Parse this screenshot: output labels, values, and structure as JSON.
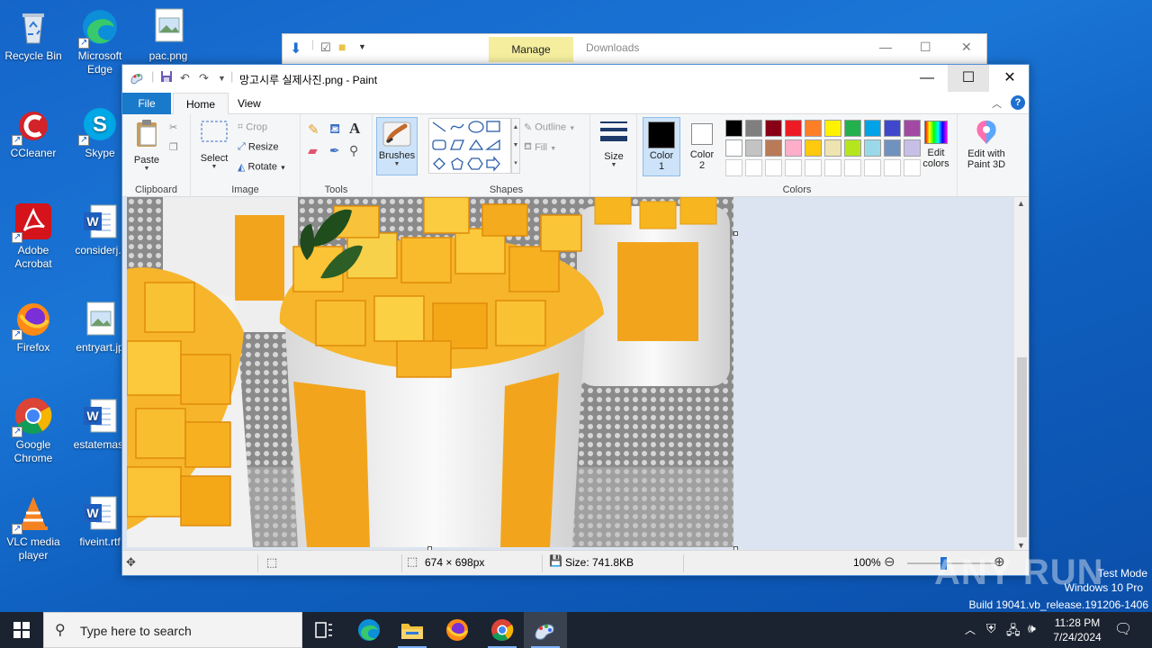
{
  "desktop": {
    "icons": [
      {
        "label": "Recycle Bin",
        "icon": "recycle-bin-icon"
      },
      {
        "label": "Microsoft Edge",
        "icon": "edge-icon"
      },
      {
        "label": "pac.png",
        "icon": "image-file-icon"
      },
      {
        "label": "CCleaner",
        "icon": "ccleaner-icon"
      },
      {
        "label": "Skype",
        "icon": "skype-icon"
      },
      {
        "label": "Adobe Acrobat",
        "icon": "acrobat-icon"
      },
      {
        "label": "considerj.r",
        "icon": "word-doc-icon"
      },
      {
        "label": "Firefox",
        "icon": "firefox-icon"
      },
      {
        "label": "entryart.jp",
        "icon": "image-file-icon"
      },
      {
        "label": "Google Chrome",
        "icon": "chrome-icon"
      },
      {
        "label": "estatemast",
        "icon": "word-doc-icon"
      },
      {
        "label": "VLC media player",
        "icon": "vlc-icon"
      },
      {
        "label": "fiveint.rtf",
        "icon": "word-doc-icon"
      }
    ]
  },
  "explorer": {
    "context_tab": "Manage",
    "title": "Downloads"
  },
  "paint": {
    "title": "망고시루 실제사진.png - Paint",
    "menu": {
      "file": "File",
      "home": "Home",
      "view": "View"
    },
    "clipboard": {
      "paste": "Paste",
      "group": "Clipboard"
    },
    "image": {
      "select": "Select",
      "crop": "Crop",
      "resize": "Resize",
      "rotate": "Rotate",
      "group": "Image"
    },
    "tools": {
      "group": "Tools",
      "brushes": "Brushes"
    },
    "shapes": {
      "outline": "Outline",
      "fill": "Fill",
      "group": "Shapes"
    },
    "size": {
      "label": "Size"
    },
    "colors": {
      "color1": "Color\n1",
      "color1_a": "Color",
      "color1_b": "1",
      "color2_a": "Color",
      "color2_b": "2",
      "edit_a": "Edit",
      "edit_b": "colors",
      "paint3d_a": "Edit with",
      "paint3d_b": "Paint 3D",
      "group": "Colors",
      "palette_row1": [
        "#000000",
        "#7f7f7f",
        "#880015",
        "#ed1c24",
        "#ff7f27",
        "#fff200",
        "#22b14c",
        "#00a2e8",
        "#3f48cc",
        "#a349a4"
      ],
      "palette_row2": [
        "#ffffff",
        "#c3c3c3",
        "#b97a57",
        "#ffaec9",
        "#ffc90e",
        "#efe4b0",
        "#b5e61d",
        "#99d9ea",
        "#7092be",
        "#c8bfe7"
      ]
    },
    "status": {
      "dimensions": "674 × 698px",
      "size": "Size: 741.8KB",
      "zoom": "100%"
    }
  },
  "watermark": {
    "brand": "ANY RUN",
    "line1": "Test Mode",
    "line2": "Windows 10 Pro",
    "line3": "Build 19041.vb_release.191206-1406"
  },
  "taskbar": {
    "search_placeholder": "Type here to search",
    "time": "11:28 PM",
    "date": "7/24/2024"
  }
}
